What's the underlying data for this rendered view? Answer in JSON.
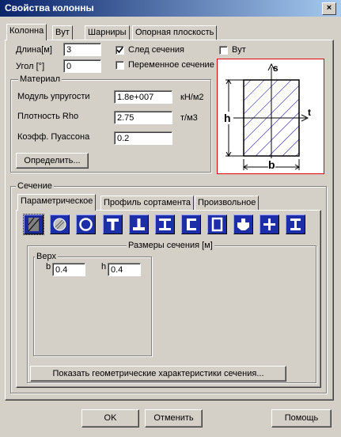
{
  "window": {
    "title": "Свойства колонны",
    "close_glyph": "×"
  },
  "tabs": [
    "Колонна",
    "Вут",
    "Шарниры",
    "Опорная плоскость"
  ],
  "column": {
    "length_label": "Длина[м]",
    "length_value": "3",
    "angle_label": "Угол [°]",
    "angle_value": "0",
    "trace_label": "След сечения",
    "trace_checked": true,
    "variable_label": "Переменное сечение",
    "variable_checked": false,
    "vut_label": "Вут",
    "vut_checked": false
  },
  "material": {
    "group_label": "Материал",
    "modulus_label": "Модуль упругости",
    "modulus_value": "1.8e+007",
    "modulus_unit": "кН/м2",
    "density_label": "Плотность Rho",
    "density_value": "2.75",
    "density_unit": "т/м3",
    "poisson_label": "Коэфф. Пуассона",
    "poisson_value": "0.2",
    "define_button": "Определить..."
  },
  "preview": {
    "label_s": "s",
    "label_t": "t",
    "label_h": "h",
    "label_b": "b"
  },
  "section": {
    "group_label": "Сечение",
    "tabs": [
      "Параметрическое",
      "Профиль сортамента",
      "Произвольное"
    ],
    "shape_icons": [
      "rect-section-icon",
      "circle-section-icon",
      "ring-section-icon",
      "tee-section-icon",
      "inverted-tee-section-icon",
      "i-beam-section-icon",
      "channel-section-icon",
      "box-section-icon",
      "custom-section-icon",
      "cross-section-icon",
      "double-tee-section-icon"
    ],
    "dims_label": "Размеры сечения [м]",
    "top_label": "Верх",
    "b_label": "b",
    "b_value": "0.4",
    "h_label": "h",
    "h_value": "0.4",
    "show_geometry_button": "Показать геометрические характеристики сечения..."
  },
  "footer": {
    "ok": "OK",
    "cancel": "Отменить",
    "help": "Помощь"
  }
}
